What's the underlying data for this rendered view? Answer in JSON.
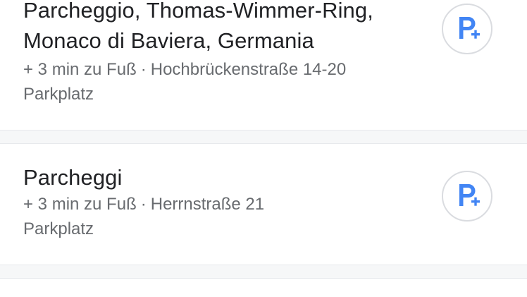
{
  "results": [
    {
      "title_line1": "Parcheggio, Thomas-Wimmer-Ring,",
      "title_line2": "Monaco di Baviera, Germania",
      "walk_time": "+ 3 min zu Fuß",
      "separator": "·",
      "address": "Hochbrückenstraße 14-20",
      "type": "Parkplatz",
      "icon": "parking-plus-icon"
    },
    {
      "title_line1": "Parcheggi",
      "walk_time": "+ 3 min zu Fuß",
      "separator": "·",
      "address": "Herrnstraße 21",
      "type": "Parkplatz",
      "icon": "parking-plus-icon"
    }
  ],
  "colors": {
    "title": "#202124",
    "secondary_text": "#686b6f",
    "icon_blue": "#4285f4",
    "badge_border": "#dadce0",
    "divider": "#f6f7f8"
  }
}
